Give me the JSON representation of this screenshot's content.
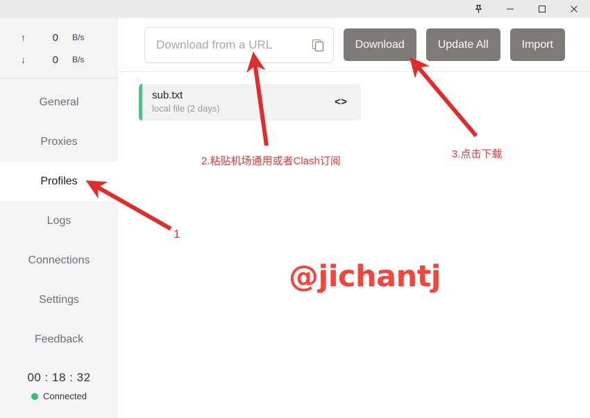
{
  "window": {
    "controls": [
      {
        "name": "pin",
        "label": "Pin"
      },
      {
        "name": "minimize",
        "label": "Minimize"
      },
      {
        "name": "maximize",
        "label": "Maximize"
      },
      {
        "name": "close",
        "label": "Close"
      }
    ]
  },
  "sidebar": {
    "traffic": {
      "upload": {
        "arrow": "↑",
        "value": "0",
        "unit": "B/s"
      },
      "download": {
        "arrow": "↓",
        "value": "0",
        "unit": "B/s"
      }
    },
    "items": [
      {
        "label": "General",
        "active": false
      },
      {
        "label": "Proxies",
        "active": false
      },
      {
        "label": "Profiles",
        "active": true
      },
      {
        "label": "Logs",
        "active": false
      },
      {
        "label": "Connections",
        "active": false
      },
      {
        "label": "Settings",
        "active": false
      },
      {
        "label": "Feedback",
        "active": false
      }
    ],
    "status": {
      "timer": "00 : 18 : 32",
      "connection": "Connected",
      "dot_color": "#2fbf71"
    }
  },
  "toolbar": {
    "url_placeholder": "Download from a URL",
    "url_value": "",
    "copy_icon": "copy-icon",
    "buttons": [
      {
        "label": "Download"
      },
      {
        "label": "Update All"
      },
      {
        "label": "Import"
      }
    ],
    "button_color": "#7d7a78"
  },
  "profiles": [
    {
      "title": "sub.txt",
      "subtitle": "local file (2 days)",
      "accent": "#4cc184",
      "code_icon": "<>"
    }
  ],
  "annotations": {
    "step1": "1",
    "step2": "2.粘贴机场通用或者Clash订阅",
    "step3": "3.点击下载",
    "color": "#e32b2b"
  },
  "watermark": {
    "text": "@jichantj",
    "color": "#f4453c"
  }
}
